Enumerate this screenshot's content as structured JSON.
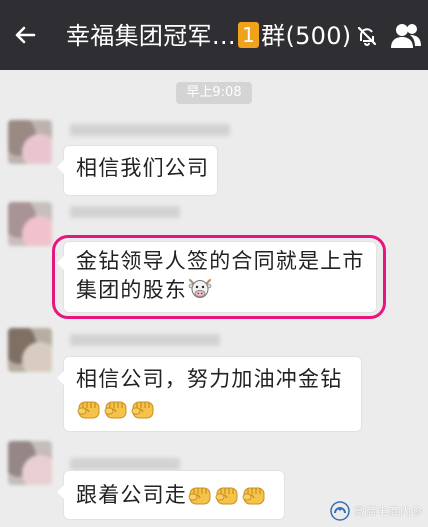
{
  "header": {
    "back_icon": "back-arrow-icon",
    "title_prefix": "幸福集团冠军…",
    "title_badge": "1",
    "title_suffix": "群(500)",
    "mute_icon": "mute-bell-icon",
    "members_icon": "group-members-icon",
    "badge_color": "#f0a21c"
  },
  "chat": {
    "timestamp": "早上9:08",
    "messages": [
      {
        "text": "相信我们公司"
      },
      {
        "line1": "金钻领导人签的合同就是上市",
        "line2": "集团的股东",
        "emoji": "cow-face-emoji",
        "highlight_color": "#e7157e"
      },
      {
        "line1": "相信公司，努力加油冲金钻",
        "emoji": "fist-emoji",
        "emoji_count": 3
      },
      {
        "text": "跟着公司走",
        "emoji": "fist-emoji",
        "emoji_count": 3
      }
    ]
  },
  "watermark": {
    "text": "微商电商内参",
    "icon": "wechat-official-account-icon"
  }
}
